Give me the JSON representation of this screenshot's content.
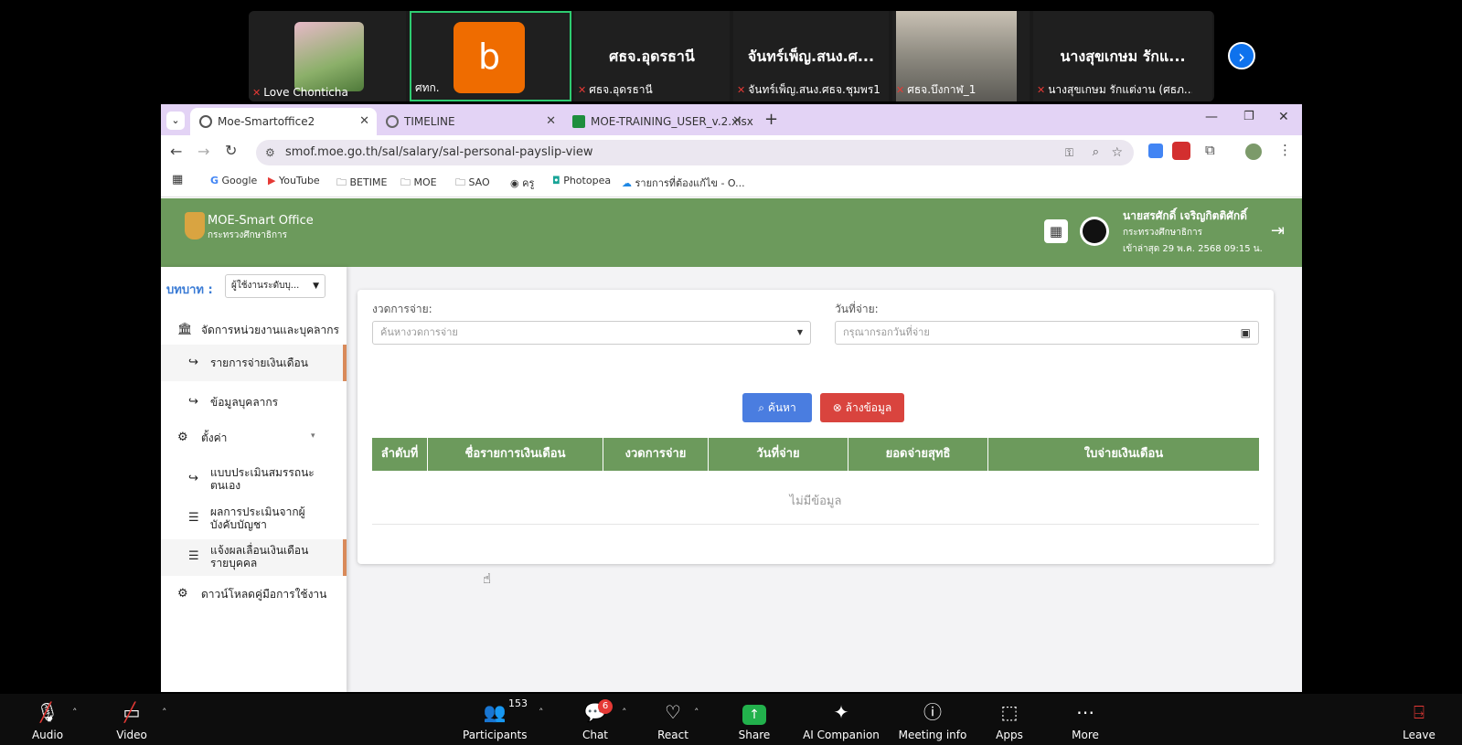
{
  "participants_strip": {
    "tiles": [
      {
        "name": "Love Chonticha"
      },
      {
        "name": "ศทก.",
        "avatar_letter": "b"
      },
      {
        "name": "ศธจ.อุดรธานี",
        "display": "ศธจ.อุดรธานี"
      },
      {
        "name": "จันทร์เพ็ญ.สนง.ศธจ.ชุมพร1",
        "display": "จันทร์เพ็ญ.สนง.ศ..."
      },
      {
        "name": "ศธจ.บึงกาฬ_1"
      },
      {
        "name": "นางสุขเกษม รักแต่งาน (ศธภ....",
        "display": "นางสุขเกษม รักแ..."
      }
    ]
  },
  "browser": {
    "tabs": [
      {
        "label": "Moe-Smartoffice2"
      },
      {
        "label": "TIMELINE"
      },
      {
        "label": "MOE-TRAINING_USER_v.2.xlsx"
      }
    ],
    "url": "smof.moe.go.th/sal/salary/sal-personal-payslip-view",
    "bookmarks": [
      "Google",
      "YouTube",
      "BETIME",
      "MOE",
      "SAO",
      "ครู",
      "Photopea",
      "รายการที่ต้องแก้ไข - O..."
    ]
  },
  "header": {
    "app_name": "MOE-Smart Office",
    "org": "กระทรวงศึกษาธิการ",
    "user_name": "นายสรศักดิ์ เจริญกิตติศักดิ์",
    "user_org": "กระทรวงศึกษาธิการ",
    "last_login": "เข้าล่าสุด 29 พ.ค. 2568 09:15 น."
  },
  "sidebar": {
    "role_label": "บทบาท :",
    "role_value": "ผู้ใช้งานระดับบุ...",
    "items": [
      {
        "label": "จัดการหน่วยงานและบุคลากร"
      },
      {
        "label": "รายการจ่ายเงินเดือน"
      },
      {
        "label": "ข้อมูลบุคลากร"
      },
      {
        "label": "ตั้งค่า"
      },
      {
        "label": "แบบประเมินสมรรถนะตนเอง"
      },
      {
        "label": "ผลการประเมินจากผู้บังคับบัญชา"
      },
      {
        "label": "แจ้งผลเลื่อนเงินเดือนรายบุคคล"
      },
      {
        "label": "ดาวน์โหลดคู่มือการใช้งาน"
      }
    ]
  },
  "form": {
    "period_label": "งวดการจ่าย:",
    "period_placeholder": "ค้นหางวดการจ่าย",
    "date_label": "วันที่จ่าย:",
    "date_placeholder": "กรุณากรอกวันที่จ่าย",
    "search_button": "ค้นหา",
    "clear_button": "ล้างข้อมูล"
  },
  "table": {
    "columns": [
      "ลำดับที่",
      "ชื่อรายการเงินเดือน",
      "งวดการจ่าย",
      "วันที่จ่าย",
      "ยอดจ่ายสุทธิ",
      "ใบจ่ายเงินเดือน"
    ],
    "empty_text": "ไม่มีข้อมูล"
  },
  "zoom_toolbar": {
    "audio": "Audio",
    "video": "Video",
    "participants": "Participants",
    "participants_count": "153",
    "chat": "Chat",
    "chat_badge": "6",
    "react": "React",
    "share": "Share",
    "ai_companion": "AI Companion",
    "meeting_info": "Meeting info",
    "apps": "Apps",
    "more": "More",
    "leave": "Leave"
  }
}
